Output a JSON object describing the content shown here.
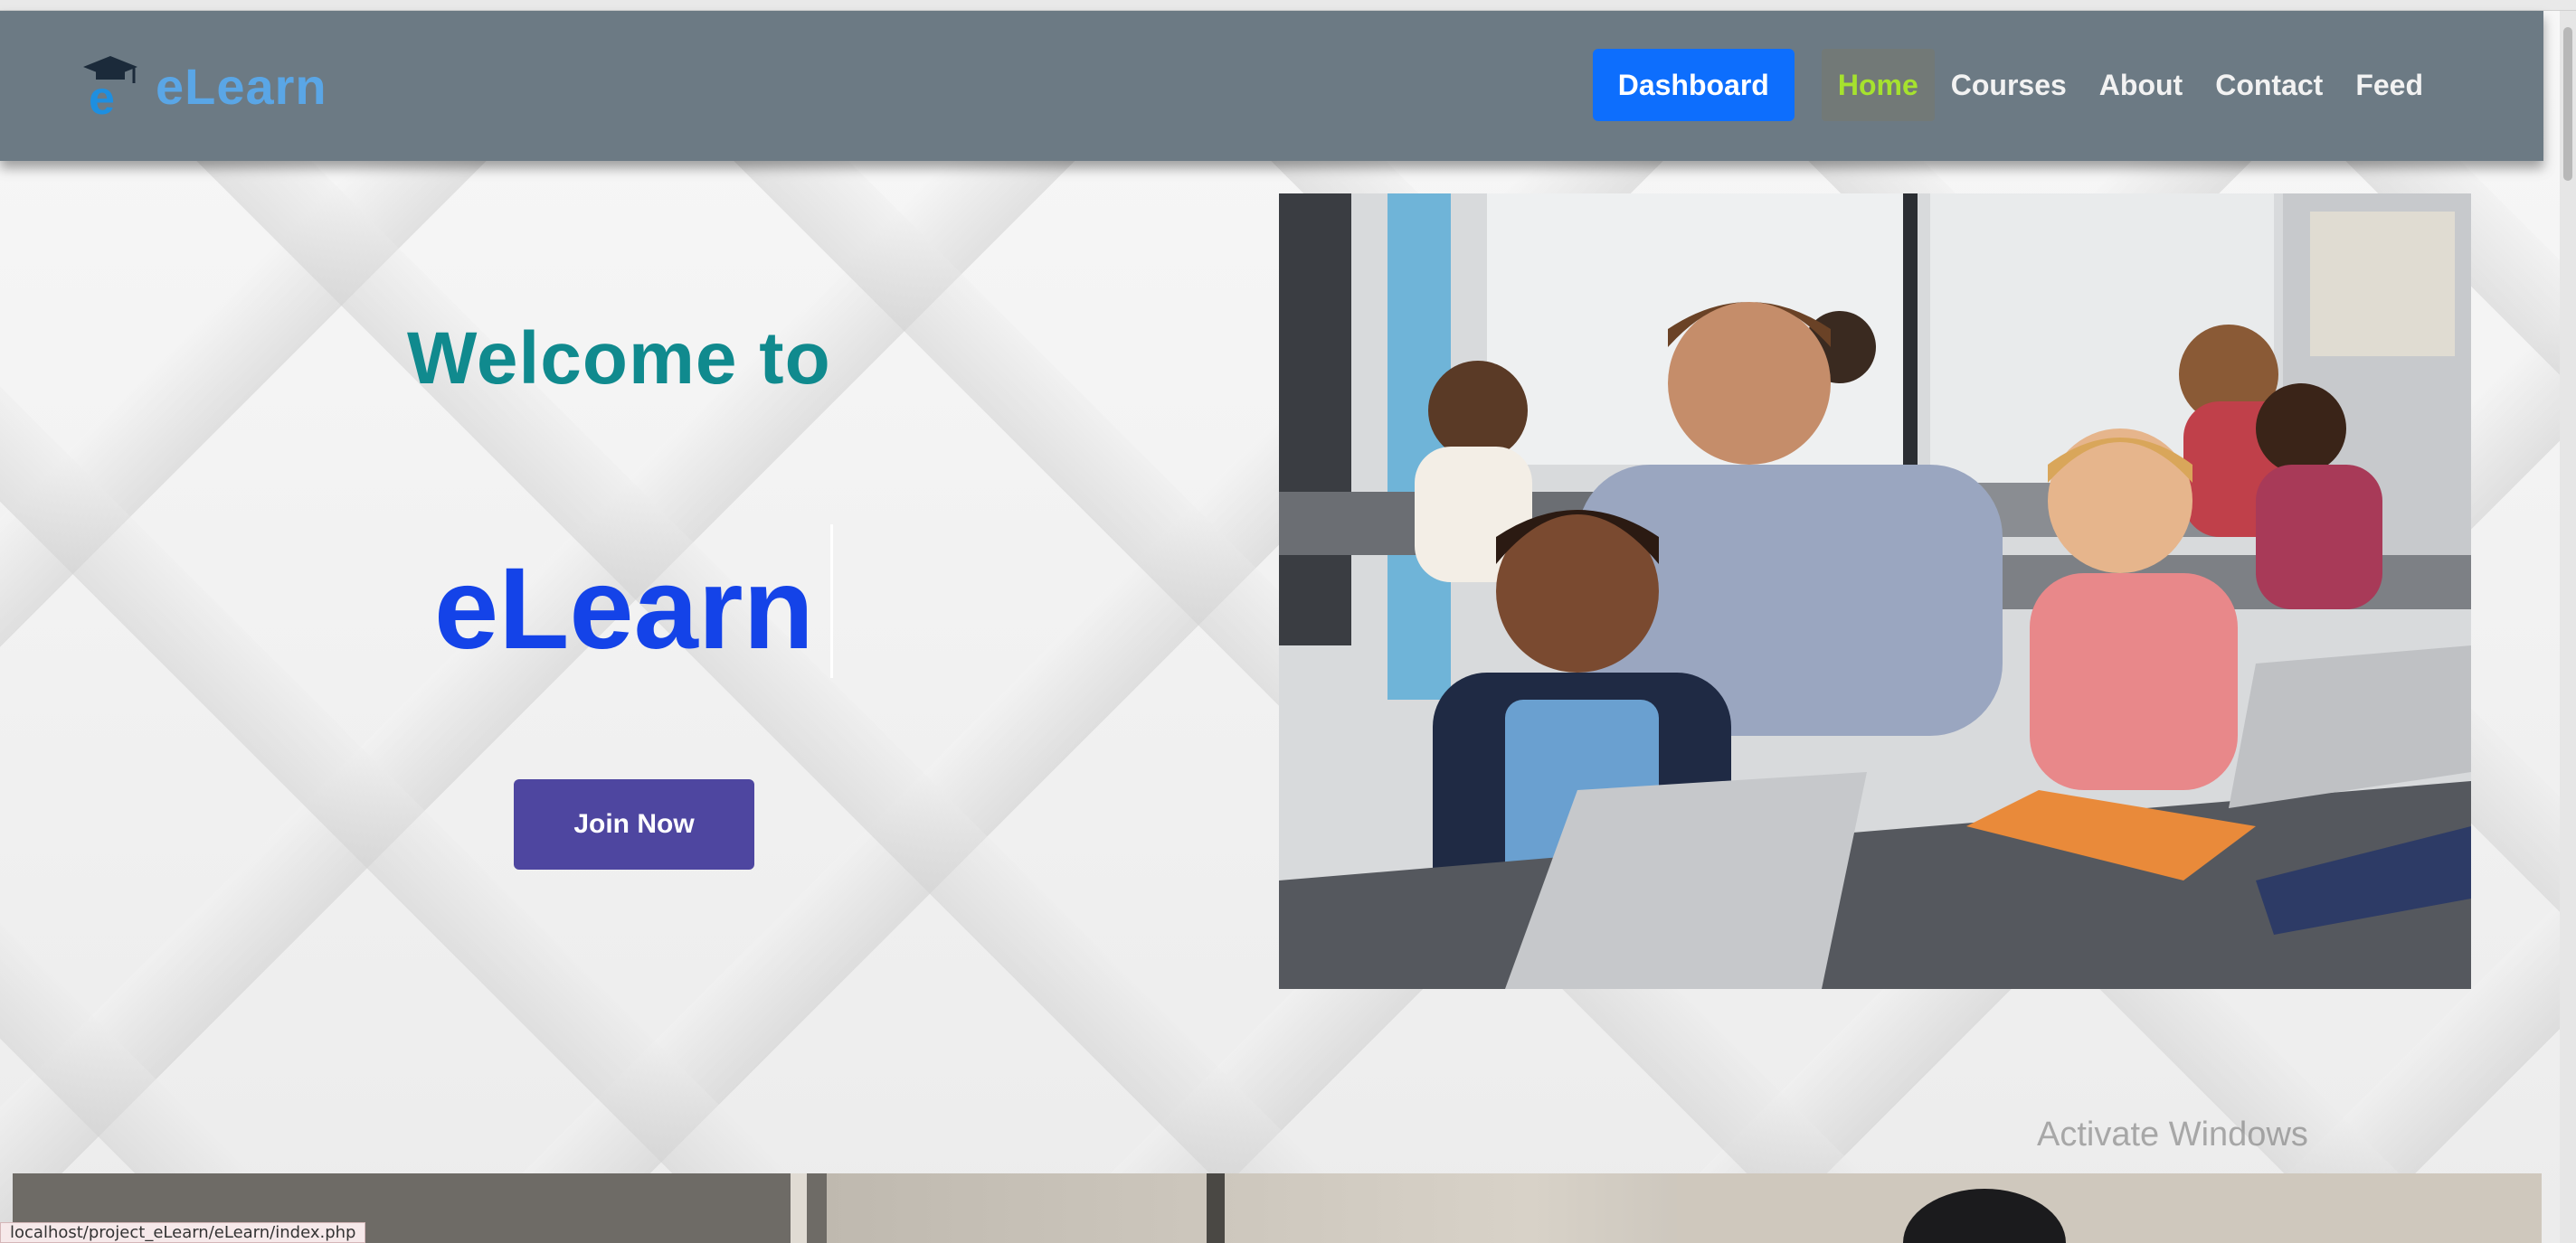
{
  "brand": {
    "name": "eLearn",
    "logo_icon": "graduation-cap-e-icon"
  },
  "nav": {
    "dashboard_label": "Dashboard",
    "links": [
      {
        "label": "Home",
        "active": true
      },
      {
        "label": "Courses",
        "active": false
      },
      {
        "label": "About",
        "active": false
      },
      {
        "label": "Contact",
        "active": false
      },
      {
        "label": "Feed",
        "active": false
      }
    ]
  },
  "hero": {
    "welcome": "Welcome to",
    "title": "eLearn",
    "join_label": "Join Now"
  },
  "overlay": {
    "watermark": "Activate Windows",
    "status_url": "localhost/project_eLearn/eLearn/index.php"
  },
  "colors": {
    "navbar": "#6c7a84",
    "dashboard_button": "#0d6efd",
    "active_link": "#a6e22e",
    "welcome_text": "#108a8e",
    "title_text": "#1443e8",
    "join_button": "#4e46a0"
  }
}
